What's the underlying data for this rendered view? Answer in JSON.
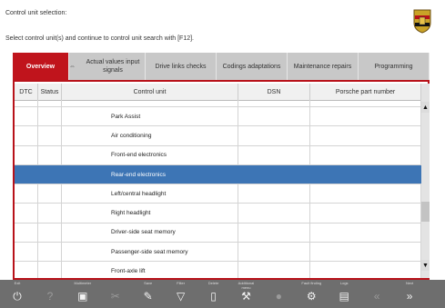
{
  "header": {
    "title": "Control unit selection:",
    "instruction": "Select control unit(s) and continue to control unit search with [F12]."
  },
  "tabs": [
    {
      "label": "Overview",
      "active": true
    },
    {
      "label": "Actual values input signals",
      "active": false
    },
    {
      "label": "Drive links checks",
      "active": false
    },
    {
      "label": "Codings adaptations",
      "active": false
    },
    {
      "label": "Maintenance repairs",
      "active": false
    },
    {
      "label": "Programming",
      "active": false
    }
  ],
  "table": {
    "columns": [
      "DTC",
      "Status",
      "Control unit",
      "DSN",
      "Porsche part number"
    ],
    "rows": [
      {
        "control_unit": "Park Assist",
        "selected": false
      },
      {
        "control_unit": "Air conditioning",
        "selected": false
      },
      {
        "control_unit": "Front-end electronics",
        "selected": false
      },
      {
        "control_unit": "Rear-end electronics",
        "selected": true
      },
      {
        "control_unit": "Left/central headlight",
        "selected": false
      },
      {
        "control_unit": "Right headlight",
        "selected": false
      },
      {
        "control_unit": "Driver-side seat memory",
        "selected": false
      },
      {
        "control_unit": "Passenger-side seat memory",
        "selected": false
      },
      {
        "control_unit": "Front-axle lift",
        "selected": false
      }
    ],
    "selected_color": "#3d75b5"
  },
  "colors": {
    "accent": "#c0141c",
    "toolbar": "#6e6e6e"
  },
  "toolbar": [
    {
      "label": "Exit",
      "icon": "power-icon"
    },
    {
      "label": "",
      "icon": "help-icon"
    },
    {
      "label": "Multimeter",
      "icon": "multimeter-icon"
    },
    {
      "label": "",
      "icon": "tools-icon"
    },
    {
      "label": "Save",
      "icon": "save-icon"
    },
    {
      "label": "Filter",
      "icon": "filter-icon"
    },
    {
      "label": "Delete",
      "icon": "delete-icon"
    },
    {
      "label": "Additional menu",
      "icon": "wrench-icon"
    },
    {
      "label": "",
      "icon": "record-icon"
    },
    {
      "label": "Fault finding",
      "icon": "fault-finding-icon"
    },
    {
      "label": "Logs",
      "icon": "logs-icon"
    },
    {
      "label": "",
      "icon": "back-icon"
    },
    {
      "label": "Next",
      "icon": "next-icon"
    }
  ]
}
